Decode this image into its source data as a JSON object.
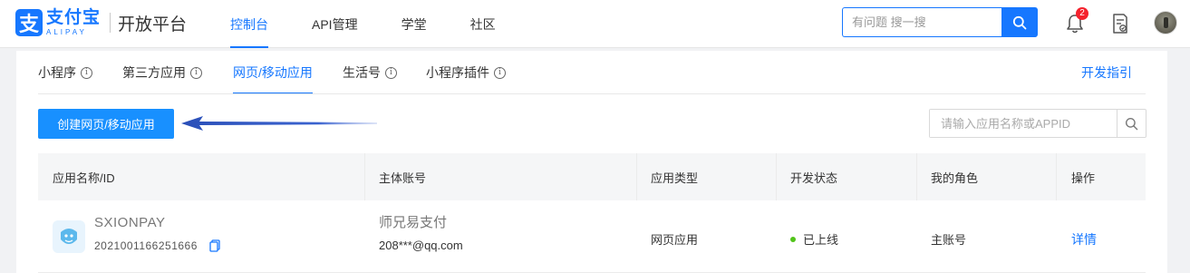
{
  "header": {
    "logo_mark": "支",
    "logo_cn": "支付宝",
    "logo_en": "ALIPAY",
    "platform": "开放平台",
    "nav": [
      {
        "label": "控制台",
        "active": true
      },
      {
        "label": "API管理",
        "active": false
      },
      {
        "label": "学堂",
        "active": false
      },
      {
        "label": "社区",
        "active": false
      }
    ],
    "search_placeholder": "有问题 搜一搜",
    "notification_count": "2"
  },
  "subtabs": {
    "items": [
      {
        "label": "小程序",
        "info": true
      },
      {
        "label": "第三方应用",
        "info": true
      },
      {
        "label": "网页/移动应用",
        "info": false,
        "active": true
      },
      {
        "label": "生活号",
        "info": true
      },
      {
        "label": "小程序插件",
        "info": true
      }
    ],
    "dev_guide": "开发指引"
  },
  "toolbar": {
    "create_button": "创建网页/移动应用",
    "search_placeholder": "请输入应用名称或APPID"
  },
  "table": {
    "columns": [
      "应用名称/ID",
      "主体账号",
      "应用类型",
      "开发状态",
      "我的角色",
      "操作"
    ],
    "rows": [
      {
        "app_name": "SXIONPAY",
        "app_id": "2021001166251666",
        "owner_name": "师兄易支付",
        "owner_account": "208***@qq.com",
        "app_type": "网页应用",
        "status": "已上线",
        "role": "主账号",
        "action": "详情"
      }
    ]
  },
  "colors": {
    "primary": "#1677ff",
    "button": "#1890ff",
    "status_online": "#52c41a",
    "badge": "#f5222d"
  }
}
